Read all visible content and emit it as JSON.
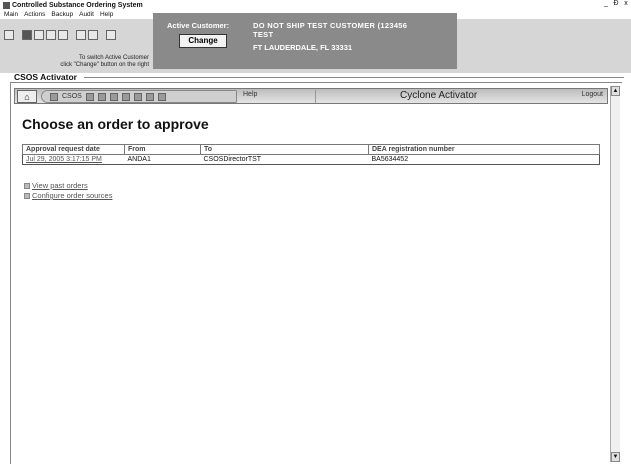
{
  "window": {
    "title": "Controlled Substance Ordering System",
    "controls": [
      "_",
      "Ɖ",
      "x"
    ]
  },
  "menu": [
    "Main",
    "Actions",
    "Backup",
    "Audit",
    "Help"
  ],
  "customer": {
    "switch_hint_line1": "To switch Active Customer",
    "switch_hint_line2": "click \"Change\" button on the right",
    "label": "Active Customer:",
    "name_line1": "DO NOT SHIP TEST CUSTOMER (123456",
    "name_line2": "TEST",
    "address": "FT LAUDERDALE, FL 33331",
    "change_label": "Change"
  },
  "activator_label": "CSOS Activator",
  "nav": {
    "home_icon": "⌂",
    "csos_label": "CSOS",
    "help_label": "Help",
    "title": "Cyclone Activator",
    "logout_label": "Logout"
  },
  "page": {
    "heading": "Choose an order to approve"
  },
  "table": {
    "headers": [
      "Approval request date",
      "From",
      "To",
      "DEA registration number"
    ],
    "rows": [
      [
        "Jul 29, 2005 3:17:15 PM",
        "ANDA1",
        "CSOSDirectorTST",
        "BA5634452"
      ]
    ]
  },
  "links": {
    "view_past": "View past orders",
    "configure": "Configure order sources"
  },
  "colors": {
    "panel": "#8a8a8a",
    "toolbar": "#d6d6d6"
  }
}
